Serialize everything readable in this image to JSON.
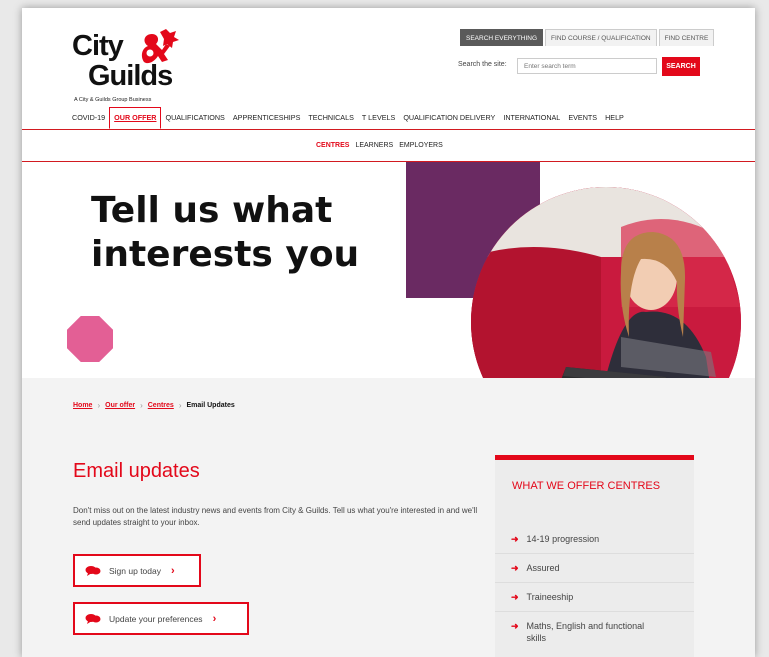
{
  "logo": {
    "line1": "City",
    "line2": "Guilds",
    "tagline": "A City & Guilds Group Business"
  },
  "header": {
    "tabs": [
      "SEARCH EVERYTHING",
      "FIND COURSE / QUALIFICATION",
      "FIND CENTRE"
    ],
    "search_label": "Search the site:",
    "search_placeholder": "Enter search term",
    "search_button": "SEARCH"
  },
  "nav": {
    "items": [
      "COVID-19",
      "OUR OFFER",
      "QUALIFICATIONS",
      "APPRENTICESHIPS",
      "TECHNICALS",
      "T LEVELS",
      "QUALIFICATION DELIVERY",
      "INTERNATIONAL",
      "EVENTS",
      "HELP"
    ],
    "active": "OUR OFFER"
  },
  "subnav": {
    "items": [
      "CENTRES",
      "LEARNERS",
      "EMPLOYERS"
    ],
    "active": "CENTRES"
  },
  "hero": {
    "title_line1": "Tell us what",
    "title_line2": "interests you"
  },
  "breadcrumb": {
    "home": "Home",
    "offer": "Our offer",
    "centres": "Centres",
    "current": "Email Updates"
  },
  "main": {
    "heading": "Email updates",
    "lead": "Don't miss out on the latest industry news and events from City & Guilds. Tell us what you're interested in and we'll send updates straight to your inbox.",
    "cta_signup": "Sign up today",
    "cta_prefs": "Update your preferences"
  },
  "sidebar": {
    "title": "WHAT WE OFFER CENTRES",
    "items": [
      "14-19 progression",
      "Assured",
      "Traineeship",
      "Maths, English and functional skills"
    ]
  },
  "colors": {
    "brand_red": "#e3081a",
    "purple": "#6a2a62",
    "pink": "#e35f95"
  }
}
